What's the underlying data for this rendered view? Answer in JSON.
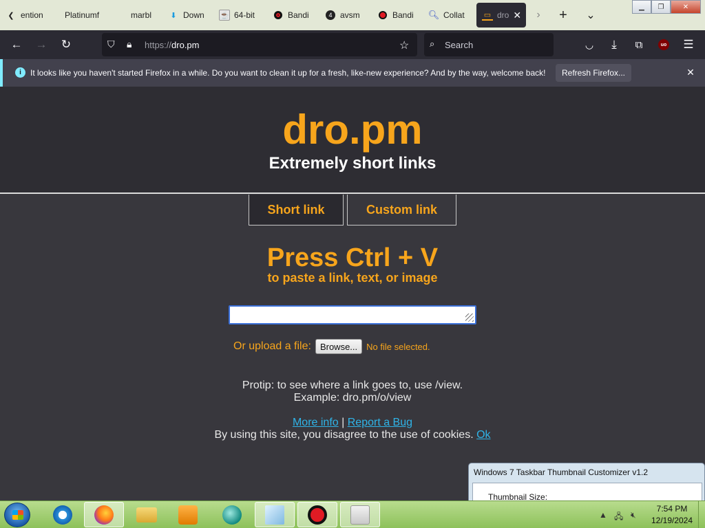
{
  "browser": {
    "tabs": [
      {
        "label": "ention",
        "icon": "chevron-left-icon"
      },
      {
        "label": "Platinumf",
        "icon": "tab-icon"
      },
      {
        "label": "marbl",
        "icon": "tab-icon"
      },
      {
        "label": "Down",
        "icon": "download-arrow-icon"
      },
      {
        "label": "64-bit",
        "icon": "java-icon"
      },
      {
        "label": "Bandi",
        "icon": "record-icon"
      },
      {
        "label": "avsm",
        "icon": "number-4-icon"
      },
      {
        "label": "Bandi",
        "icon": "record-icon"
      },
      {
        "label": "Collat",
        "icon": "search-icon"
      },
      {
        "label": "dro",
        "icon": "dropm-icon"
      }
    ],
    "url": {
      "scheme": "https://",
      "host": "dro.pm"
    },
    "search_placeholder": "Search",
    "notification": {
      "text": "It looks like you haven't started Firefox in a while. Do you want to clean it up for a fresh, like-new experience? And by the way, welcome back!",
      "button": "Refresh Firefox..."
    }
  },
  "page": {
    "title": "dro.pm",
    "subtitle": "Extremely short links",
    "tabs": {
      "short": "Short link",
      "custom": "Custom link"
    },
    "press": "Press Ctrl + V",
    "press_sub": "to paste a link, text, or image",
    "upload_label": "Or upload a file:",
    "browse_button": "Browse...",
    "file_status": "No file selected.",
    "protip_line1": "Protip: to see where a link goes to, use /view.",
    "protip_line2": "Example: dro.pm/o/view",
    "more_info": "More info",
    "separator": "|",
    "report_bug": "Report a Bug",
    "cookie_text": "By using this site, you disagree to the use of cookies.",
    "cookie_ok": "Ok",
    "colors": {
      "accent": "#f7a51c",
      "link": "#2fb4e8",
      "background": "#38373d"
    }
  },
  "utility_window": {
    "title": "Windows 7 Taskbar Thumbnail Customizer v1.2",
    "label": "Thumbnail Size:"
  },
  "taskbar": {
    "clock_time": "7:54 PM",
    "clock_date": "12/19/2024"
  }
}
